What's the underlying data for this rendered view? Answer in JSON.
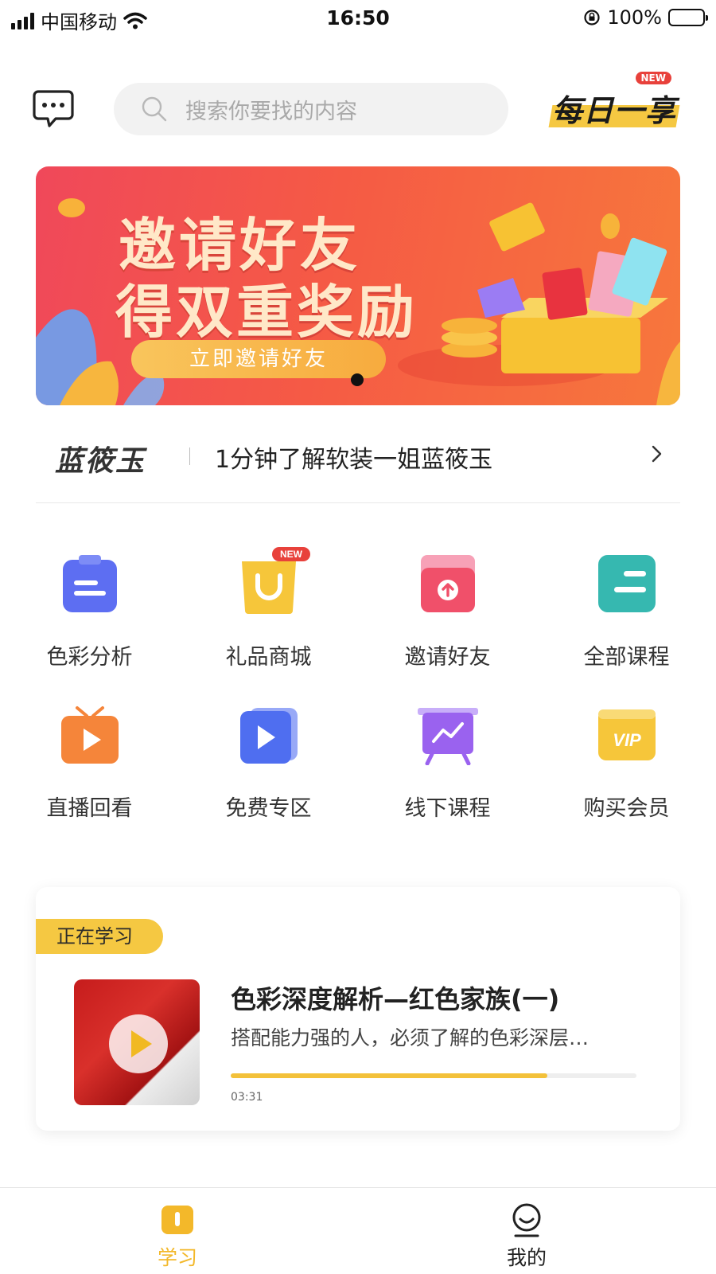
{
  "status_bar": {
    "carrier": "中国移动",
    "time": "16:50",
    "battery": "100%"
  },
  "header": {
    "search_placeholder": "搜索你要找的内容",
    "daily_label": "每日一享",
    "daily_badge": "NEW"
  },
  "banner": {
    "line1": "邀请好友",
    "line2": "得双重奖励",
    "cta": "立即邀请好友",
    "colors": {
      "start": "#f0485a",
      "end": "#f7773c"
    }
  },
  "notice": {
    "brand": "蓝筱玉",
    "text": "1分钟了解软装一姐蓝筱玉"
  },
  "grid": {
    "items": [
      {
        "label": "色彩分析",
        "icon": "clipboard-icon",
        "color": "#5d6ef2"
      },
      {
        "label": "礼品商城",
        "icon": "shopping-bag-icon",
        "color": "#f6c63a",
        "badge": "NEW"
      },
      {
        "label": "邀请好友",
        "icon": "envelope-upload-icon",
        "color": "#f0506a"
      },
      {
        "label": "全部课程",
        "icon": "course-list-icon",
        "color": "#36b8b0"
      },
      {
        "label": "直播回看",
        "icon": "tv-play-icon",
        "color": "#f5853a"
      },
      {
        "label": "免费专区",
        "icon": "video-play-icon",
        "color": "#4f6ef0"
      },
      {
        "label": "线下课程",
        "icon": "presentation-board-icon",
        "color": "#9a62ef"
      },
      {
        "label": "购买会员",
        "icon": "vip-card-icon",
        "color": "#f6c63a"
      }
    ]
  },
  "learning": {
    "tag": "正在学习",
    "title": "色彩深度解析—红色家族(一)",
    "desc": "搭配能力强的人，必须了解的色彩深层…",
    "progress": 0.78,
    "time": "03:31"
  },
  "tabbar": {
    "tabs": [
      {
        "label": "学习",
        "icon": "book-icon",
        "active": true
      },
      {
        "label": "我的",
        "icon": "profile-icon",
        "active": false
      }
    ],
    "active_color": "#f3b82a"
  }
}
